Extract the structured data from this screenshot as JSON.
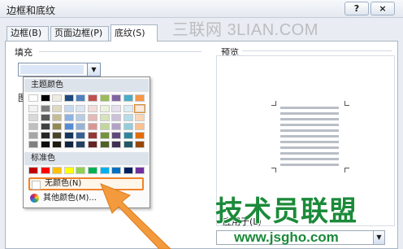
{
  "window": {
    "title": "边框和底纹",
    "help_label": "?",
    "close_label": "×"
  },
  "watermark_top": "三联网 3LIAN.COM",
  "tabs": [
    {
      "label": "边框(B)"
    },
    {
      "label": "页面边框(P)"
    },
    {
      "label": "底纹(S)"
    }
  ],
  "fill": {
    "label": "填充"
  },
  "left_label": "图",
  "dropdown": {
    "theme_header": "主题颜色",
    "theme_top_row": [
      "#ffffff",
      "#000000",
      "#eeece1",
      "#1f497d",
      "#4f81bd",
      "#c0504d",
      "#9bbb59",
      "#8064a2",
      "#4bacc6",
      "#f79646"
    ],
    "theme_columns": [
      [
        "#f2f2f2",
        "#d9d9d9",
        "#bfbfbf",
        "#a6a6a6",
        "#808080"
      ],
      [
        "#7f7f7f",
        "#595959",
        "#404040",
        "#262626",
        "#0d0d0d"
      ],
      [
        "#ddd9c3",
        "#c4bd97",
        "#938953",
        "#494429",
        "#1d1b10"
      ],
      [
        "#c6d9f0",
        "#8db3e2",
        "#548dd4",
        "#17365d",
        "#0f243e"
      ],
      [
        "#dbe5f1",
        "#b8cce4",
        "#95b3d7",
        "#366092",
        "#244061"
      ],
      [
        "#f2dcdb",
        "#e5b9b7",
        "#d99694",
        "#953734",
        "#632423"
      ],
      [
        "#ebf1dd",
        "#d7e3bc",
        "#c3d69b",
        "#76923c",
        "#4f6128"
      ],
      [
        "#e5e0ec",
        "#ccc1d9",
        "#b2a2c7",
        "#5f497a",
        "#3f3151"
      ],
      [
        "#dbeef3",
        "#b7dde8",
        "#92cddc",
        "#31859b",
        "#205867"
      ],
      [
        "#fde9d9",
        "#fbd5b5",
        "#fac08f",
        "#e36c09",
        "#974806"
      ]
    ],
    "standard_header": "标准色",
    "standard_colors": [
      "#c00000",
      "#ff0000",
      "#ffc000",
      "#ffff00",
      "#92d050",
      "#00b050",
      "#00b0f0",
      "#0070c0",
      "#002060",
      "#7030a0"
    ],
    "no_color_label": "无颜色(N)",
    "more_colors_label": "其他颜色(M)..."
  },
  "preview": {
    "label": "预览"
  },
  "apply_to_label": "应用于(L)",
  "watermark_brand": "技术员联盟",
  "watermark_url": "www.jsgho.com",
  "colors": {
    "highlight": "#f0832a",
    "arrow": "#f29a3c",
    "brand_green": "#1b8a3a"
  }
}
